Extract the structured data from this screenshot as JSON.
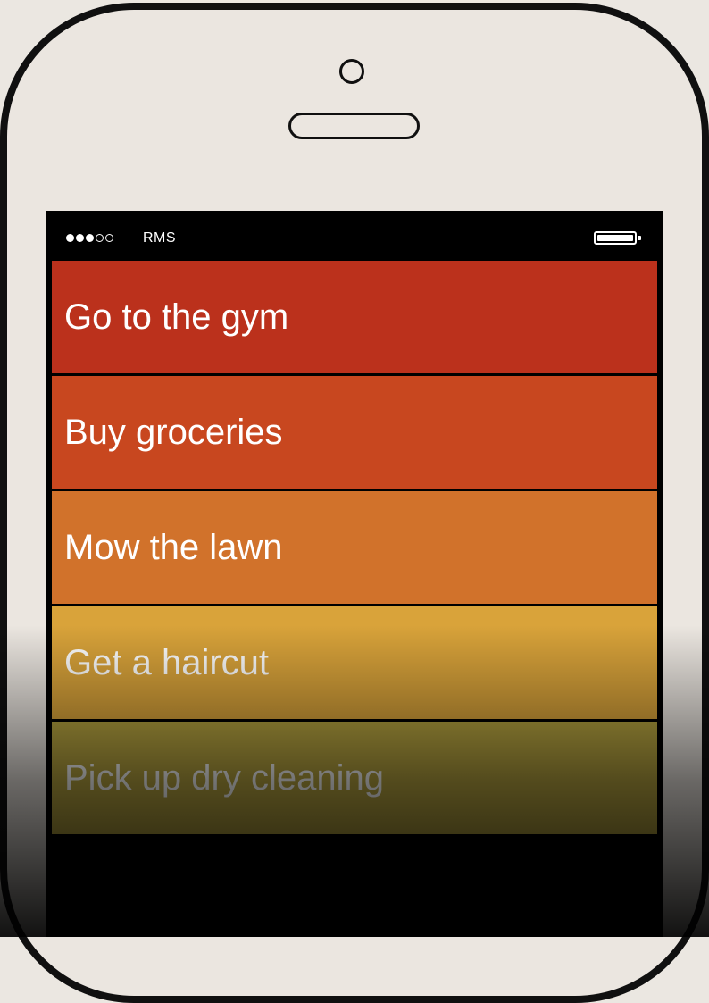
{
  "status_bar": {
    "signal": [
      "full",
      "full",
      "full",
      "empty",
      "empty"
    ],
    "carrier": "RMS",
    "battery_level": 1.0
  },
  "tasks": [
    {
      "label": "Go to the gym",
      "color": "#bb311c"
    },
    {
      "label": "Buy groceries",
      "color": "#c8471f"
    },
    {
      "label": "Mow the lawn",
      "color": "#d1722b"
    },
    {
      "label": "Get a haircut",
      "color": "#d9a33a"
    },
    {
      "label": "Pick up dry cleaning",
      "color": "#b8a540"
    }
  ]
}
